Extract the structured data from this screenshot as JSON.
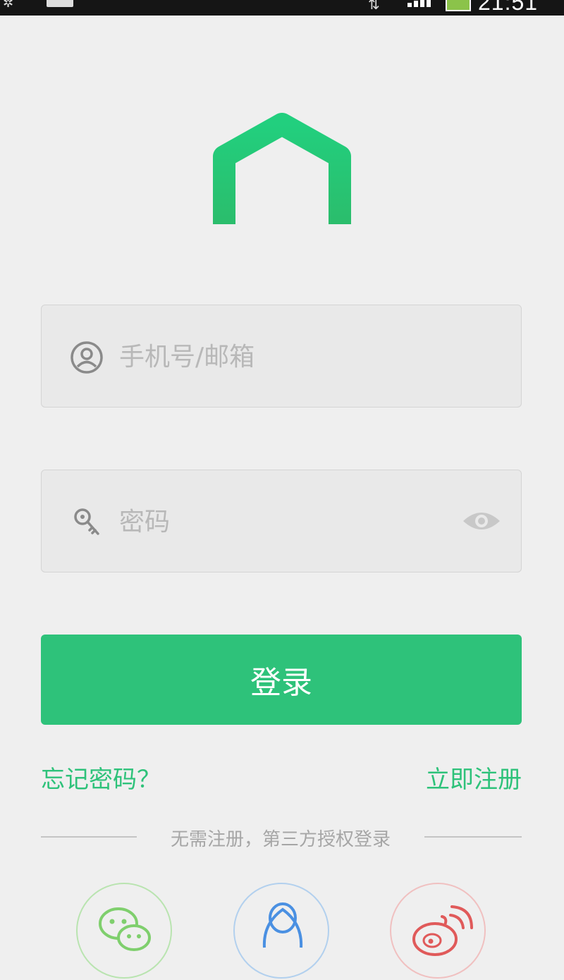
{
  "status_bar": {
    "time": "21:51"
  },
  "login_form": {
    "username_placeholder": "手机号/邮箱",
    "password_placeholder": "密码",
    "login_button_label": "登录",
    "forgot_password_label": "忘记密码？",
    "register_label": "立即注册"
  },
  "third_party": {
    "divider_text": "无需注册，第三方授权登录",
    "providers": [
      "wechat-icon",
      "qq-icon",
      "weibo-icon"
    ]
  },
  "colors": {
    "accent": "#2ec27a",
    "background": "#efefef",
    "field_background": "#e9e9e9"
  }
}
